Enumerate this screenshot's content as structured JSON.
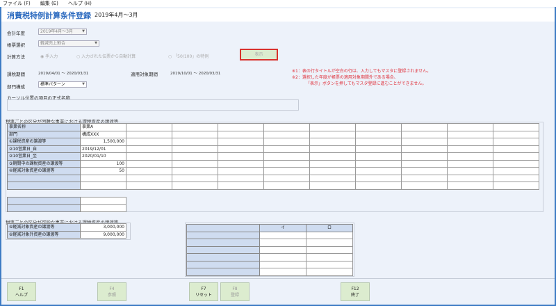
{
  "menu": [
    "ファイル (F)",
    "編集 (E)",
    "ヘルプ (H)"
  ],
  "header": {
    "title": "消費税特例計算条件登録",
    "period": "2019年4月～3月"
  },
  "form": {
    "fiscal_year_label": "会計年度",
    "fiscal_year_value": "2019年4月～3月",
    "form_select_label": "帳票選択",
    "form_select_value": "軽減売上割合",
    "calc_method_label": "計算方法",
    "radios": [
      "手入力",
      "入力された伝票から自動計算",
      "「50/100」の特例"
    ],
    "show_button": "表示",
    "taxable_period_label": "課税期間",
    "taxable_period_value": "2019/04/01 ～ 2020/03/31",
    "target_period_label": "適用対象期間",
    "target_period_value": "2019/10/01 ～ 2020/03/31",
    "dept_label": "部門構成",
    "dept_value": "標準パターン",
    "cursor_label": "カーソル位置の項目の正式名称"
  },
  "notes": [
    "※1：表の行タイトルが空白の行は、入力してもマスタに登録されません。",
    "※2：選択した年度が帳票の適用対象期間外である場合、",
    "「表示」ボタンを押してもマスタ登録に進むことができません。"
  ],
  "grid1": {
    "title": "税率ごとの区分が困難な事業における課税資産の譲渡等",
    "rows": [
      {
        "label": "事業名称",
        "value": "事業A",
        "align": "left"
      },
      {
        "label": "部門",
        "value": "構成XXX",
        "align": "left"
      },
      {
        "label": "①課税資産の譲渡等",
        "value": "1,500,000",
        "align": "right"
      },
      {
        "label": "②10営業日_自",
        "value": "2019/12/01",
        "align": "left"
      },
      {
        "label": "②10営業日_至",
        "value": "2020/01/10",
        "align": "left"
      },
      {
        "label": "③期間中の課税資産の譲渡等",
        "value": "100",
        "align": "right"
      },
      {
        "label": "④軽減対象資産の譲渡等",
        "value": "50",
        "align": "right"
      },
      {
        "label": "",
        "value": "",
        "align": "left"
      },
      {
        "label": "",
        "value": "",
        "align": "left"
      }
    ]
  },
  "grid3": {
    "title": "税率ごとの区分が可能な事業における課税資産の譲渡等",
    "rows": [
      {
        "label": "⑤軽減対象資産の譲渡等",
        "value": "3,000,000"
      },
      {
        "label": "⑥軽減対象外資産の譲渡等",
        "value": "9,000,000"
      }
    ]
  },
  "grid4": {
    "headers": [
      "",
      "イ",
      "ロ"
    ]
  },
  "footer": [
    {
      "key": "F1",
      "label": "ヘルプ",
      "enabled": true
    },
    {
      "key": "F4",
      "label": "参照",
      "enabled": false
    },
    {
      "key": "F7",
      "label": "リセット",
      "enabled": true
    },
    {
      "key": "F8",
      "label": "登録",
      "enabled": false
    },
    {
      "key": "F12",
      "label": "終了",
      "enabled": true
    }
  ]
}
